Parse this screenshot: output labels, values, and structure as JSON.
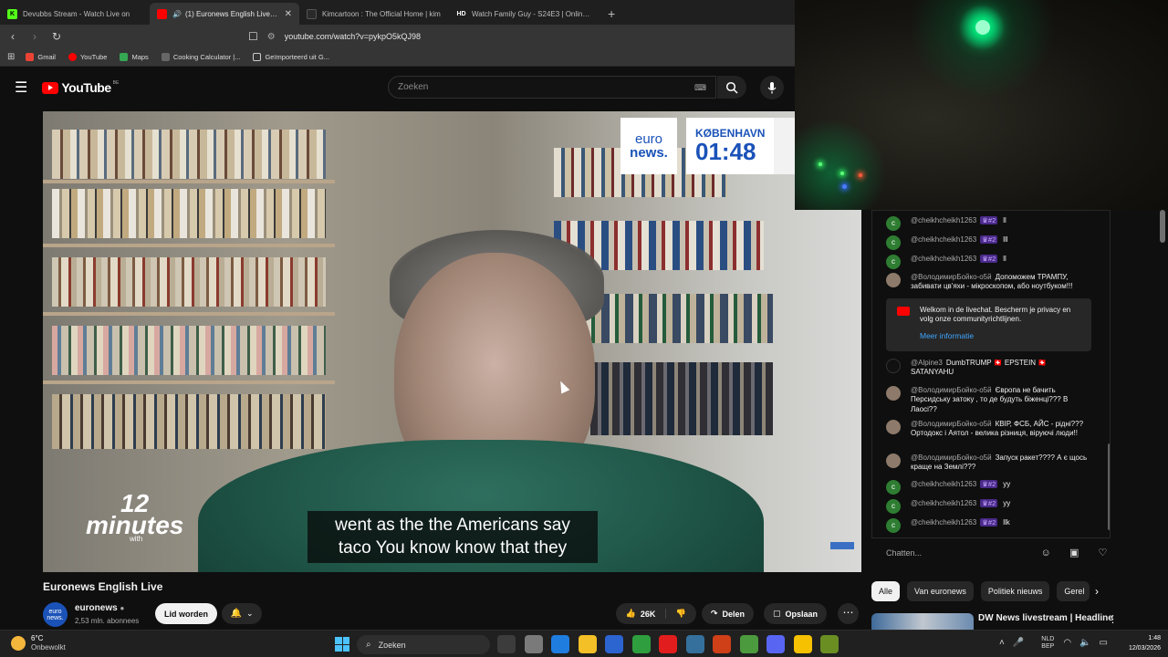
{
  "browser": {
    "tabs": [
      {
        "title": "Devubbs Stream - Watch Live on",
        "fav": "K",
        "color": "#53fc18"
      },
      {
        "title": "(1) Euronews English Live - Yo",
        "fav": "",
        "color": "#ff0000",
        "active": true
      },
      {
        "title": "Kimcartoon : The Official Home | kim",
        "fav": "",
        "color": "#2a2a2a"
      },
      {
        "title": "Watch Family Guy - S24E3 | Online H",
        "fav": "HD",
        "color": "#1f1f1f"
      }
    ],
    "url": "youtube.com/watch?v=pykpO5kQJ98",
    "bookmarks": [
      {
        "label": "Gmail",
        "color": "#ea4335"
      },
      {
        "label": "YouTube",
        "color": "#ff0000"
      },
      {
        "label": "Maps",
        "color": "#34a853"
      },
      {
        "label": "Cooking Calculator |...",
        "color": "#666666"
      },
      {
        "label": "Geïmporteerd uit G...",
        "color": "#888888"
      }
    ]
  },
  "youtube": {
    "logo": "YouTube",
    "country": "BE",
    "search_placeholder": "Zoeken"
  },
  "video": {
    "badge_line1": "euro",
    "badge_line2": "news.",
    "city": "KØBENHAVN",
    "time": "01:48",
    "show_num": "12",
    "show_word": "minutes",
    "show_with": "with",
    "caption_line1": "went as the the Americans say",
    "caption_line2": "taco You know know that they",
    "title": "Euronews English Live"
  },
  "channel": {
    "name": "euronews",
    "avatar_text": "euro news.",
    "subs": "2,53 mln. abonnees",
    "join_label": "Lid worden",
    "likes": "26K",
    "share_label": "Delen",
    "save_label": "Opslaan"
  },
  "chat": {
    "messages": [
      {
        "avatar": "c",
        "author": "@cheikhcheikh1263",
        "badge": "♛#2",
        "text": "ll"
      },
      {
        "avatar": "c",
        "author": "@cheikhcheikh1263",
        "badge": "♛#2",
        "text": "lll"
      },
      {
        "avatar": "c",
        "author": "@cheikhcheikh1263",
        "badge": "♛#2",
        "text": "ll"
      },
      {
        "avatar": "v",
        "author": "@ВолодимирБойко-о5й",
        "badge": "",
        "text": "Допоможем ТРАМПУ, забивати цв'яхи - мікроскопом, або ноутбуком!!!"
      },
      {
        "avatar": "a",
        "author": "@Alpine3",
        "badge": "",
        "text": "DumbTRUMP 🇨🇭 EPSTEIN 🇨🇭 SATANYAHU"
      },
      {
        "avatar": "v",
        "author": "@ВолодимирБойко-о5й",
        "badge": "",
        "text": "Європа не бачить Перcидську затоку , то де будуть біженці??? В Лаосі??"
      },
      {
        "avatar": "v",
        "author": "@ВолодимирБойко-о5й",
        "badge": "",
        "text": "КВІР, ФСБ, АЙС - рідні??? Ортодокс і Аятол - велика різниця, віруючі люди!!"
      },
      {
        "avatar": "v",
        "author": "@ВолодимирБойко-о5й",
        "badge": "",
        "text": "Запуск ракет???? А є щось краще на Землі???"
      },
      {
        "avatar": "c",
        "author": "@cheikhcheikh1263",
        "badge": "♛#2",
        "text": "yy"
      },
      {
        "avatar": "c",
        "author": "@cheikhcheikh1263",
        "badge": "♛#2",
        "text": "yy"
      },
      {
        "avatar": "c",
        "author": "@cheikhcheikh1263",
        "badge": "♛#2",
        "text": "llk"
      }
    ],
    "welcome_text": "Welkom in de livechat. Bescherm je privacy en volg onze communityrichtlijnen.",
    "welcome_link": "Meer informatie",
    "input_placeholder": "Chatten..."
  },
  "chips": [
    "Alle",
    "Van euronews",
    "Politiek nieuws",
    "Gerel"
  ],
  "recommended": {
    "title": "DW News livestream | Headline"
  },
  "taskbar": {
    "temp": "6°C",
    "condition": "Onbewolkt",
    "search": "Zoeken",
    "lang1": "NLD",
    "lang2": "BEP",
    "time": "1:48",
    "date": "12/03/2026",
    "icons": [
      "#3c3c3c",
      "#7a7a7a",
      "#1f7de0",
      "#f3c027",
      "#2c64d0",
      "#2e9e3e",
      "#e21d1d",
      "#35709c",
      "#cf3f18",
      "#4c9a3e",
      "#5865f2",
      "#f5c100",
      "#6b8e23"
    ]
  }
}
